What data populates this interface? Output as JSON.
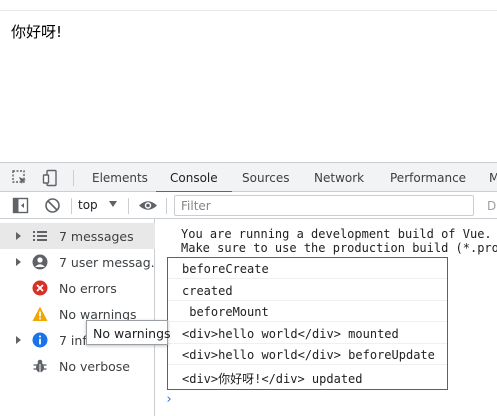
{
  "page": {
    "text": "你好呀!"
  },
  "devtools": {
    "tabs": [
      "Elements",
      "Console",
      "Sources",
      "Network",
      "Performance",
      "M"
    ],
    "active_tab": "Console",
    "toolbar": {
      "context": "top",
      "filter_placeholder": "Filter",
      "default_levels": "D"
    },
    "sidebar": {
      "items": [
        {
          "label": "7 messages",
          "icon": "list-icon",
          "expandable": true
        },
        {
          "label": "7 user messag...",
          "icon": "user-icon",
          "expandable": true
        },
        {
          "label": "No errors",
          "icon": "error-icon",
          "expandable": false
        },
        {
          "label": "No warnings",
          "icon": "warning-icon",
          "expandable": false
        },
        {
          "label": "7 info",
          "icon": "info-icon",
          "expandable": true
        },
        {
          "label": "No verbose",
          "icon": "bug-icon",
          "expandable": false
        }
      ],
      "tooltip": "No warnings"
    },
    "console": {
      "messages": [
        "You are running a development build of Vue.",
        "Make sure to use the production build (*.pro"
      ],
      "logs": [
        "beforeCreate",
        "created",
        " beforeMount",
        "<div>hello world</div> mounted",
        "<div>hello world</div> beforeUpdate",
        "<div>你好呀!</div> updated"
      ],
      "prompt": "›"
    },
    "colors": {
      "accent": "#1a73e8",
      "error": "#d93025",
      "warning": "#f2a600",
      "highlight_box": "#cc3333"
    }
  }
}
